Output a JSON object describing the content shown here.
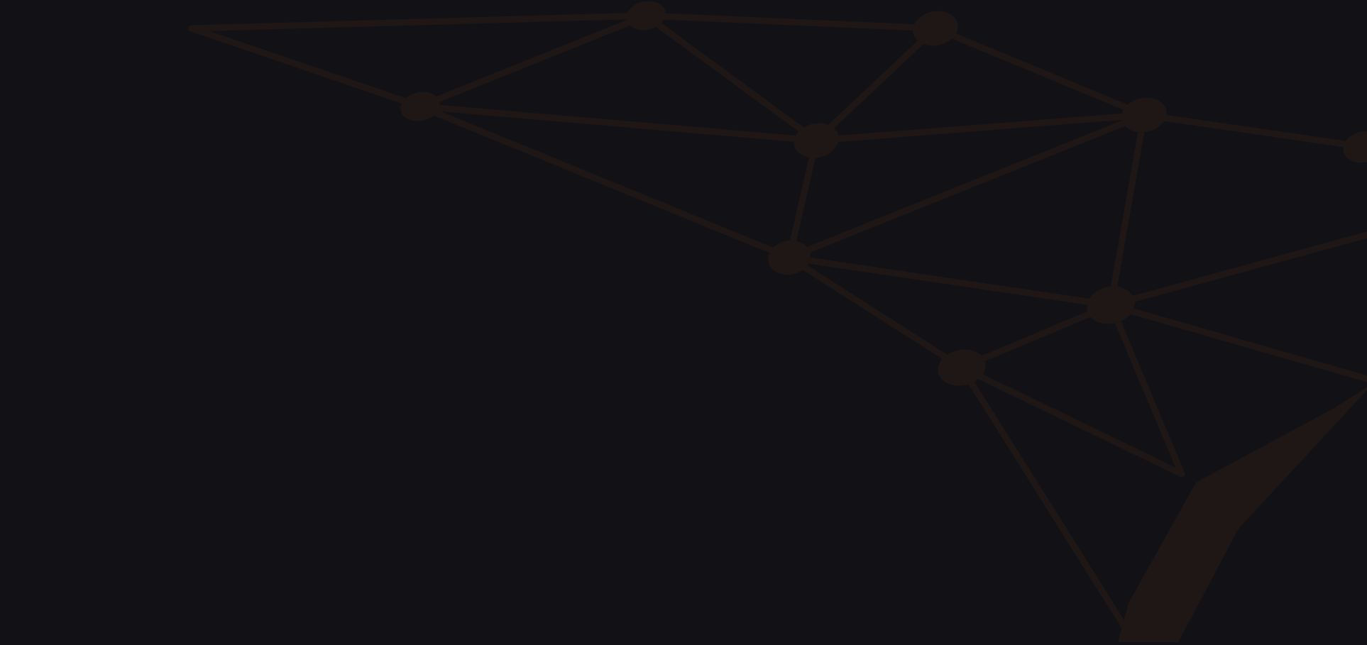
{
  "background_color": "#121216",
  "network_color": "#1f1715"
}
